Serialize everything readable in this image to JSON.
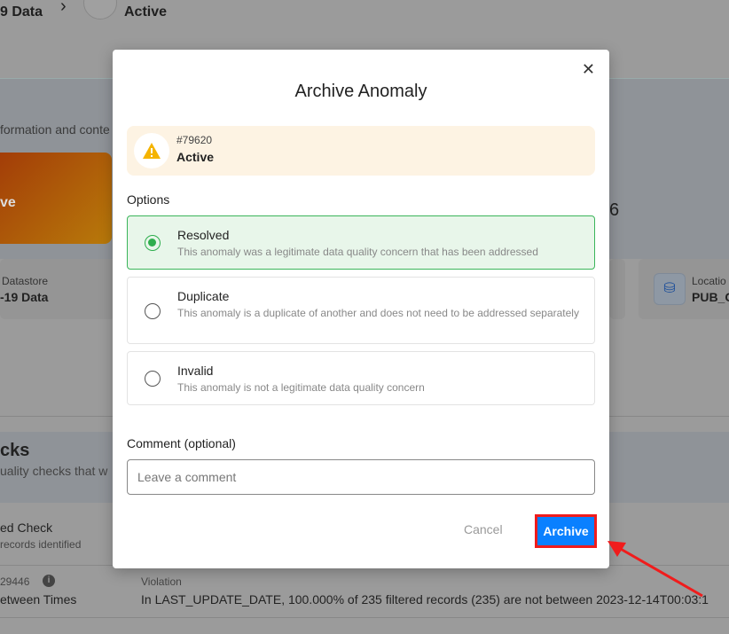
{
  "background": {
    "breadcrumb_datastore": "9 Data",
    "breadcrumb_status": "Active",
    "section_desc": "formation and conte",
    "status_card_text": "ve",
    "stat_partial": "6",
    "datastore_label": "Datastore",
    "datastore_value": "-19 Data",
    "location_label": "Locatio",
    "location_value": "PUB_C",
    "checks_title": "cks",
    "checks_desc": "uality checks that w",
    "check_name": "ed Check",
    "check_desc": "records identified",
    "check_id": "29446",
    "check_type": "etween Times",
    "violation_label": "Violation",
    "violation_text": "In LAST_UPDATE_DATE, 100.000% of 235 filtered records (235) are not between 2023-12-14T00:03:1"
  },
  "modal": {
    "title": "Archive Anomaly",
    "anomaly_id": "#79620",
    "anomaly_status": "Active",
    "options_label": "Options",
    "options": [
      {
        "label": "Resolved",
        "desc": "This anomaly was a legitimate data quality concern that has been addressed",
        "selected": true
      },
      {
        "label": "Duplicate",
        "desc": "This anomaly is a duplicate of another and does not need to be addressed separately",
        "selected": false
      },
      {
        "label": "Invalid",
        "desc": "This anomaly is not a legitimate data quality concern",
        "selected": false
      }
    ],
    "comment_label": "Comment (optional)",
    "comment_placeholder": "Leave a comment",
    "cancel_label": "Cancel",
    "archive_label": "Archive"
  },
  "colors": {
    "accent": "#0a80ff",
    "highlight": "#f01c1c",
    "selected": "#2eae4d",
    "warning": "#f5b400"
  }
}
